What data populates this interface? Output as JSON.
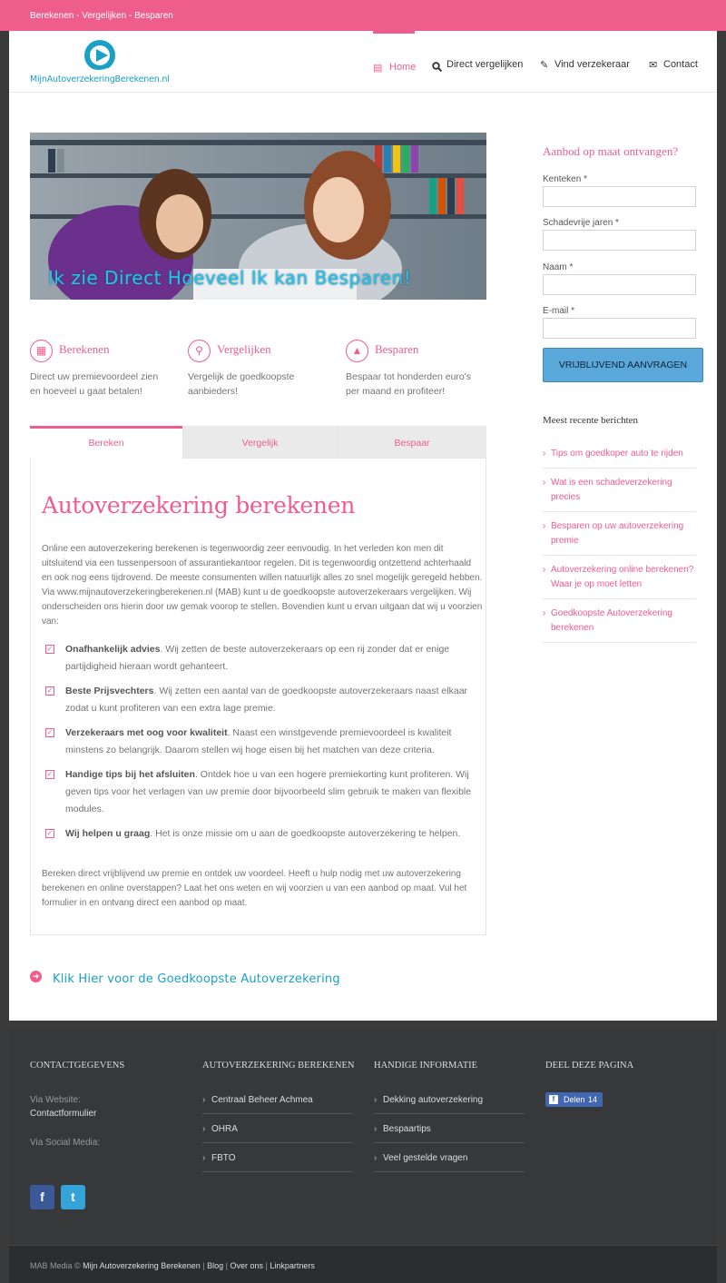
{
  "topbar": {
    "tagline": "Berekenen - Vergelijken - Besparen"
  },
  "logo": {
    "text": "MijnAutoverzekeringBerekenen.nl"
  },
  "nav": [
    {
      "label": "Home",
      "icon": "laptop-icon",
      "active": true
    },
    {
      "label": "Direct vergelijken",
      "icon": "search-icon"
    },
    {
      "label": "Vind verzekeraar",
      "icon": "pencil-icon"
    },
    {
      "label": "Contact",
      "icon": "envelope-icon"
    }
  ],
  "hero": {
    "caption": "Ik zie Direct Hoeveel Ik kan Besparen!"
  },
  "features": [
    {
      "title": "Berekenen",
      "desc": "Direct uw premievoordeel zien en hoeveel u gaat betalen!",
      "icon": "building-icon"
    },
    {
      "title": "Vergelijken",
      "desc": "Vergelijk de goedkoopste aanbieders!",
      "icon": "magnifier-icon"
    },
    {
      "title": "Besparen",
      "desc": "Bespaar tot honderden euro's per maand en profiteer!",
      "icon": "thumbs-up-icon"
    }
  ],
  "tabs": [
    {
      "label": "Bereken",
      "active": true
    },
    {
      "label": "Vergelijk"
    },
    {
      "label": "Bespaar"
    }
  ],
  "panel": {
    "title": "Autoverzekering berekenen",
    "intro": "Online een autoverzekering berekenen is tegenwoordig zeer eenvoudig. In het verleden kon men dit uitsluitend via een tussenpersoon of assurantiekantoor regelen. Dit is tegenwoordig ontzettend achterhaald en ook nog eens tijdrovend. De meeste consumenten willen natuurlijk alles zo snel mogelijk geregeld hebben. Via www.mijnautoverzekeringberekenen.nl (MAB) kunt u de goedkoopste autoverzekeraars vergelijken. Wij onderscheiden ons hierin door uw gemak voorop te stellen. Bovendien kunt u ervan uitgaan dat wij u voorzien van:",
    "checklist": [
      {
        "bold": "Onafhankelijk advies",
        "text": ". Wij zetten de beste autoverzekeraars op een rij zonder dat er enige partijdigheid hieraan wordt gehanteert."
      },
      {
        "bold": "Beste Prijsvechters",
        "text": ". Wij zetten een aantal van de goedkoopste autoverzekeraars naast elkaar zodat u kunt profiteren van een extra lage premie."
      },
      {
        "bold": "Verzekeraars met oog voor kwaliteit",
        "text": ". Naast een winstgevende premievoordeel is kwaliteit minstens zo belangrijk. Daarom stellen wij hoge eisen bij het matchen van deze criteria."
      },
      {
        "bold": "Handige tips bij het afsluiten",
        "text": ". Ontdek hoe u van een hogere premiekorting kunt profiteren. Wij geven tips voor het verlagen van uw premie door bijvoorbeeld slim gebruik te maken van flexible modules."
      },
      {
        "bold": "Wij helpen u graag",
        "text": ". Het is onze missie om u aan de goedkoopste autoverzekering te helpen."
      }
    ],
    "outro": "Bereken direct vrijblijvend uw premie en ontdek uw voordeel. Heeft u hulp nodig met uw autoverzekering berekenen en online overstappen? Laat het ons weten en wij voorzien u van een aanbod op maat. Vul het formulier in en ontvang direct een aanbod op maat."
  },
  "cta": {
    "label": "Klik Hier voor de Goedkoopste Autoverzekering"
  },
  "sidebar": {
    "title": "Aanbod op maat ontvangen?",
    "fields": [
      {
        "label": "Kenteken *",
        "value": ""
      },
      {
        "label": "Schadevrije jaren *",
        "value": ""
      },
      {
        "label": "Naam *",
        "value": ""
      },
      {
        "label": "E-mail *",
        "value": ""
      }
    ],
    "submit": "Vrijblijvend aanvragen",
    "recent_title": "Meest recente berichten",
    "recent": [
      "Tips om goedkoper auto te rijden",
      "Wat is een schadeverzekering precies",
      "Besparen op uw autoverzekering premie",
      "Autoverzekering online berekenen? Waar je op moet letten",
      "Goedkoopste Autoverzekering berekenen"
    ]
  },
  "footer": {
    "contact": {
      "heading": "Contactgegevens",
      "website_label": "Via Website:",
      "website_link": "Contactformulier",
      "social_label": "Via Social Media:"
    },
    "col2": {
      "heading": "Autoverzekering berekenen",
      "links": [
        "Centraal Beheer Achmea",
        "OHRA",
        "FBTO"
      ]
    },
    "col3": {
      "heading": "Handige informatie",
      "links": [
        "Dekking autoverzekering",
        "Bespaartips",
        "Veel gestelde vragen"
      ]
    },
    "col4": {
      "heading": "Deel deze pagina",
      "share_label": "Delen",
      "share_count": "14"
    }
  },
  "copyright": {
    "prefix": "MAB Media ©",
    "links": [
      "Mijn Autoverzekering Berekenen",
      "Blog",
      "Over ons",
      "Linkpartners"
    ]
  },
  "colors": {
    "accent": "#ef5d8c",
    "brand_blue": "#1aa0c4",
    "button": "#5aa8d9",
    "footer_bg": "#363839"
  }
}
